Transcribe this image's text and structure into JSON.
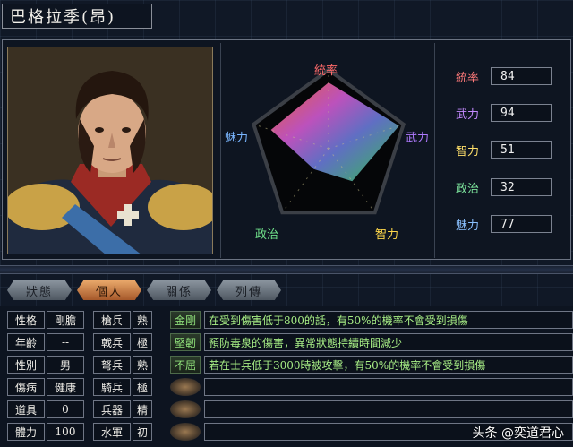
{
  "title": "巴格拉季(昂)",
  "radar": {
    "labels": {
      "tongshuai": "統率",
      "wuli": "武力",
      "zhili": "智力",
      "zhengzhi": "政治",
      "meili": "魅力"
    },
    "values": {
      "tongshuai": 84,
      "wuli": 94,
      "zhili": 51,
      "zhengzhi": 32,
      "meili": 77
    },
    "colors": {
      "tongshuai": "#ff6a6a",
      "wuli": "#b07aff",
      "zhili": "#ffd84a",
      "zhengzhi": "#6fe08a",
      "meili": "#7ab6ff"
    }
  },
  "stats": [
    {
      "name": "統率",
      "value": "84",
      "color": "#ff7a7a"
    },
    {
      "name": "武力",
      "value": "94",
      "color": "#c48aff"
    },
    {
      "name": "智力",
      "value": "51",
      "color": "#ffe06a"
    },
    {
      "name": "政治",
      "value": "32",
      "color": "#7ae09a"
    },
    {
      "name": "魅力",
      "value": "77",
      "color": "#8ac0ff"
    }
  ],
  "tabs": [
    "狀態",
    "個人",
    "關係",
    "列傳"
  ],
  "personal": [
    {
      "label": "性格",
      "value": "剛膽"
    },
    {
      "label": "年齡",
      "value": "--"
    },
    {
      "label": "性別",
      "value": "男"
    },
    {
      "label": "傷病",
      "value": "健康"
    },
    {
      "label": "道具",
      "value": "0"
    },
    {
      "label": "體力",
      "value": "100"
    }
  ],
  "troops": [
    {
      "label": "槍兵",
      "value": "熟"
    },
    {
      "label": "戟兵",
      "value": "極"
    },
    {
      "label": "弩兵",
      "value": "熟"
    },
    {
      "label": "騎兵",
      "value": "極"
    },
    {
      "label": "兵器",
      "value": "精"
    },
    {
      "label": "水軍",
      "value": "初"
    }
  ],
  "skills": [
    {
      "name": "金剛",
      "desc": "在受到傷害低于800的話，有50%的機率不會受到損傷"
    },
    {
      "name": "堅韌",
      "desc": "預防毒泉的傷害，異常狀態持續時間減少"
    },
    {
      "name": "不屈",
      "desc": "若在士兵低于3000時被攻擊，有50%的機率不會受到損傷"
    },
    {
      "name": "",
      "desc": ""
    },
    {
      "name": "",
      "desc": ""
    },
    {
      "name": "",
      "desc": ""
    }
  ],
  "watermark": "头条 @奕道君心"
}
